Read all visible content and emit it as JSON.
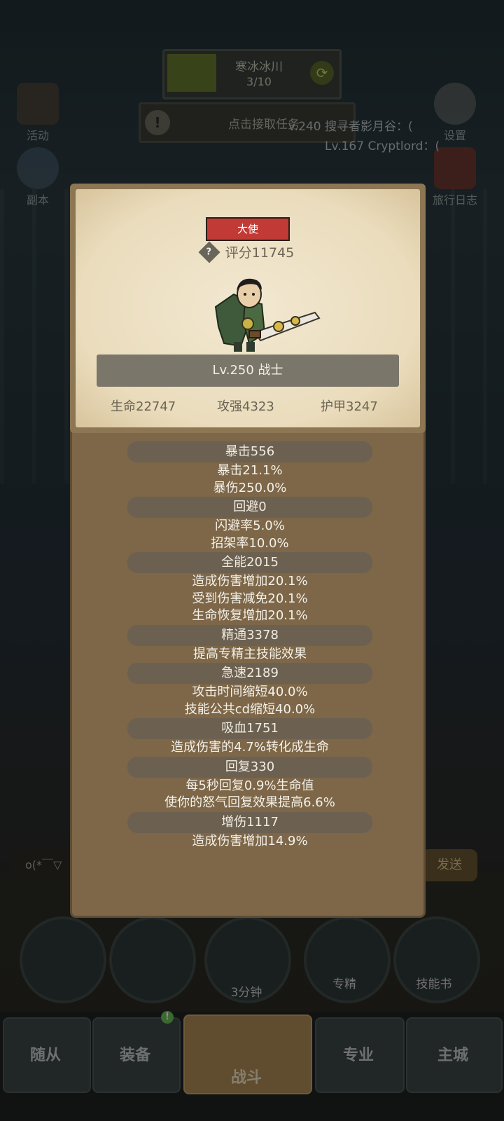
{
  "background": {
    "zone": {
      "name": "寒冰冰川",
      "progress": "3/10"
    },
    "quest": {
      "label": "点击接取任务"
    },
    "side_left": [
      {
        "label": "活动"
      },
      {
        "label": "副本"
      }
    ],
    "side_right": [
      {
        "label": "设置"
      },
      {
        "label": "旅行日志"
      }
    ],
    "chat": [
      "v.240 搜寻者影月谷：(",
      "Lv.167 Cryptlord：("
    ],
    "chat_input_text": "o(*￣▽",
    "send_label": "发送",
    "round_buttons": [
      {
        "label": ""
      },
      {
        "label": ""
      },
      {
        "label": "3分钟"
      },
      {
        "label": "专精"
      },
      {
        "label": "技能书"
      }
    ],
    "nav": [
      {
        "label": "随从"
      },
      {
        "label": "装备",
        "badge": "!"
      },
      {
        "label": "战斗"
      },
      {
        "label": "专业"
      },
      {
        "label": "主城"
      }
    ]
  },
  "profile": {
    "title": "大使",
    "help": "?",
    "score": "评分11745",
    "level_class": "Lv.250 战士",
    "hp": "生命22747",
    "attack": "攻强4323",
    "armor": "护甲3247"
  },
  "stats": [
    {
      "header": "暴击556",
      "lines": [
        "暴击21.1%",
        "暴伤250.0%"
      ]
    },
    {
      "header": "回避0",
      "lines": [
        "闪避率5.0%",
        "招架率10.0%"
      ]
    },
    {
      "header": "全能2015",
      "lines": [
        "造成伤害增加20.1%",
        "受到伤害减免20.1%",
        "生命恢复增加20.1%"
      ]
    },
    {
      "header": "精通3378",
      "lines": [
        "提高专精主技能效果"
      ]
    },
    {
      "header": "急速2189",
      "lines": [
        "攻击时间缩短40.0%",
        "技能公共cd缩短40.0%"
      ]
    },
    {
      "header": "吸血1751",
      "lines": [
        "造成伤害的4.7%转化成生命"
      ]
    },
    {
      "header": "回复330",
      "lines": [
        "每5秒回复0.9%生命值",
        "使你的怒气回复效果提高6.6%"
      ]
    },
    {
      "header": "增伤1117",
      "lines": [
        "造成伤害增加14.9%"
      ]
    }
  ]
}
